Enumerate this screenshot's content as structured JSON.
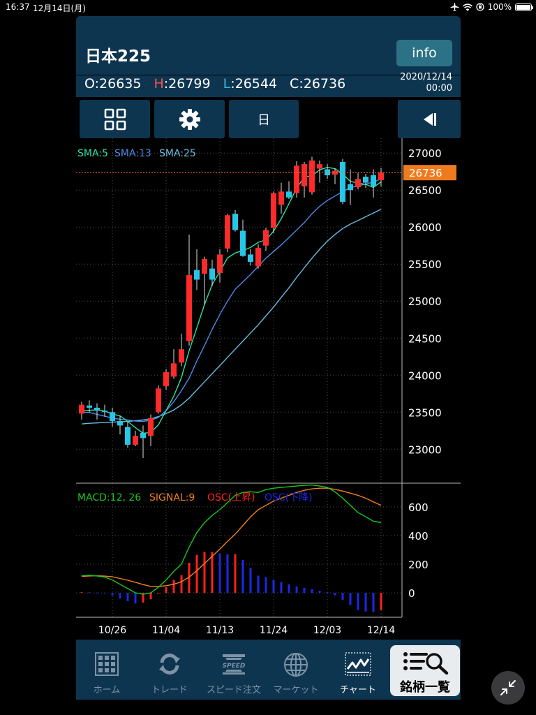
{
  "status": {
    "time": "16:37",
    "date": "12月14日(月)",
    "battery": "100%"
  },
  "header": {
    "title": "日本225",
    "info_label": "info",
    "ohlc": [
      {
        "label": "O",
        "value": ":26635"
      },
      {
        "label": "H",
        "value": ":26799"
      },
      {
        "label": "L",
        "value": ":26544"
      },
      {
        "label": "C",
        "value": ":26736"
      }
    ],
    "stamp_date": "2020/12/14",
    "stamp_time": "00:00"
  },
  "toolbar": {
    "period_label": "日"
  },
  "nav": {
    "items": [
      {
        "label": "ホーム",
        "icon": "grid-icon"
      },
      {
        "label": "トレード",
        "icon": "refresh-icon"
      },
      {
        "label": "スピード注文",
        "icon": "speed-icon"
      },
      {
        "label": "マーケット",
        "icon": "globe-icon"
      },
      {
        "label": "チャート",
        "icon": "chart-icon"
      }
    ],
    "stock_list_label": "銘柄一覧"
  },
  "colors": {
    "up": "#ff2a2a",
    "down": "#27c6e6",
    "sma5": "#2fe0a0",
    "sma13": "#4f8be8",
    "sma25": "#68bde3",
    "macd": "#18c818",
    "signal": "#f08020",
    "osc_up": "#ff2020",
    "osc_down": "#1e28e8",
    "last_price_bg": "#f07a1e",
    "panel": "#0e3550"
  },
  "chart_data": [
    {
      "type": "candlestick",
      "price_axis": {
        "ticks": [
          27000,
          26500,
          26000,
          25500,
          25000,
          24500,
          24000,
          23500,
          23000
        ],
        "range": [
          22550,
          27200
        ]
      },
      "x_tick_labels": [
        "10/26",
        "11/04",
        "11/13",
        "11/24",
        "12/03",
        "12/14"
      ],
      "legend": [
        "SMA:5",
        "SMA:13",
        "SMA:25"
      ],
      "last_price_label": "26736",
      "candles": [
        {
          "o": 23480,
          "h": 23640,
          "l": 23400,
          "c": 23600
        },
        {
          "o": 23590,
          "h": 23660,
          "l": 23500,
          "c": 23560
        },
        {
          "o": 23560,
          "h": 23620,
          "l": 23400,
          "c": 23520
        },
        {
          "o": 23520,
          "h": 23600,
          "l": 23440,
          "c": 23500
        },
        {
          "o": 23500,
          "h": 23560,
          "l": 23300,
          "c": 23380
        },
        {
          "o": 23380,
          "h": 23450,
          "l": 23200,
          "c": 23320
        },
        {
          "o": 23300,
          "h": 23370,
          "l": 23020,
          "c": 23060
        },
        {
          "o": 23060,
          "h": 23250,
          "l": 23040,
          "c": 23180
        },
        {
          "o": 23220,
          "h": 23320,
          "l": 22880,
          "c": 23150
        },
        {
          "o": 23180,
          "h": 23470,
          "l": 23040,
          "c": 23420
        },
        {
          "o": 23500,
          "h": 23860,
          "l": 23480,
          "c": 23820
        },
        {
          "o": 23850,
          "h": 24080,
          "l": 23800,
          "c": 24040
        },
        {
          "o": 23980,
          "h": 24350,
          "l": 23950,
          "c": 24160
        },
        {
          "o": 24170,
          "h": 24560,
          "l": 24120,
          "c": 24350
        },
        {
          "o": 24460,
          "h": 25900,
          "l": 24400,
          "c": 25350
        },
        {
          "o": 25420,
          "h": 25700,
          "l": 25150,
          "c": 25290
        },
        {
          "o": 25370,
          "h": 25600,
          "l": 24950,
          "c": 25570
        },
        {
          "o": 25440,
          "h": 25560,
          "l": 25200,
          "c": 25290
        },
        {
          "o": 25380,
          "h": 25700,
          "l": 25250,
          "c": 25630
        },
        {
          "o": 25710,
          "h": 26180,
          "l": 25660,
          "c": 26160
        },
        {
          "o": 26180,
          "h": 26230,
          "l": 25940,
          "c": 25960
        },
        {
          "o": 25950,
          "h": 26100,
          "l": 25600,
          "c": 25610
        },
        {
          "o": 25630,
          "h": 25700,
          "l": 25480,
          "c": 25530
        },
        {
          "o": 25470,
          "h": 25770,
          "l": 25440,
          "c": 25720
        },
        {
          "o": 25750,
          "h": 25990,
          "l": 25680,
          "c": 25960
        },
        {
          "o": 25990,
          "h": 26480,
          "l": 25920,
          "c": 26460
        },
        {
          "o": 26300,
          "h": 26600,
          "l": 26180,
          "c": 26480
        },
        {
          "o": 26480,
          "h": 26620,
          "l": 26380,
          "c": 26400
        },
        {
          "o": 26460,
          "h": 26890,
          "l": 26400,
          "c": 26830
        },
        {
          "o": 26550,
          "h": 26880,
          "l": 26400,
          "c": 26850
        },
        {
          "o": 26470,
          "h": 26950,
          "l": 26440,
          "c": 26900
        },
        {
          "o": 26790,
          "h": 26900,
          "l": 26600,
          "c": 26850
        },
        {
          "o": 26780,
          "h": 26850,
          "l": 26650,
          "c": 26700
        },
        {
          "o": 26710,
          "h": 26790,
          "l": 26580,
          "c": 26760
        },
        {
          "o": 26880,
          "h": 26920,
          "l": 26310,
          "c": 26340
        },
        {
          "o": 26580,
          "h": 26780,
          "l": 26300,
          "c": 26500
        },
        {
          "o": 26540,
          "h": 26730,
          "l": 26510,
          "c": 26650
        },
        {
          "o": 26680,
          "h": 26720,
          "l": 26530,
          "c": 26600
        },
        {
          "o": 26700,
          "h": 26780,
          "l": 26400,
          "c": 26550
        },
        {
          "o": 26635,
          "h": 26799,
          "l": 26544,
          "c": 26736
        }
      ],
      "sma5": [
        23520,
        23525,
        23530,
        23515,
        23475,
        23450,
        23375,
        23290,
        23215,
        23225,
        23330,
        23522,
        23718,
        23969,
        24330,
        24637,
        24954,
        25224,
        25399,
        25583,
        25650,
        25682,
        25725,
        25795,
        25826,
        25945,
        26114,
        26315,
        26527,
        26672,
        26694,
        26774,
        26807,
        26790,
        26718,
        26617,
        26594,
        26578,
        26535,
        26611
      ],
      "sma13": [
        23500,
        23495,
        23470,
        23445,
        23420,
        23405,
        23395,
        23380,
        23375,
        23390,
        23430,
        23520,
        23640,
        23790,
        23960,
        24190,
        24400,
        24620,
        24820,
        25000,
        25160,
        25260,
        25360,
        25470,
        25580,
        25670,
        25760,
        25860,
        25960,
        26060,
        26180,
        26280,
        26360,
        26420,
        26480,
        26530,
        26560,
        26580,
        26610,
        26650
      ],
      "sma25": [
        23340,
        23350,
        23355,
        23360,
        23365,
        23370,
        23375,
        23385,
        23395,
        23410,
        23440,
        23480,
        23530,
        23600,
        23690,
        23800,
        23910,
        24020,
        24130,
        24240,
        24350,
        24460,
        24570,
        24680,
        24800,
        24920,
        25050,
        25180,
        25320,
        25450,
        25580,
        25700,
        25810,
        25900,
        25980,
        26040,
        26090,
        26140,
        26190,
        26240
      ]
    },
    {
      "type": "macd",
      "legend": [
        "MACD:12, 26",
        "SIGNAL:9",
        "OSC(上昇)",
        "OSC(下降)"
      ],
      "y_ticks": [
        600,
        400,
        200,
        0
      ],
      "range": [
        -170,
        760
      ],
      "macd": [
        120,
        122,
        118,
        110,
        90,
        60,
        30,
        0,
        -10,
        0,
        40,
        90,
        150,
        200,
        320,
        420,
        490,
        540,
        580,
        630,
        680,
        700,
        705,
        700,
        720,
        730,
        735,
        740,
        745,
        750,
        752,
        745,
        735,
        705,
        660,
        610,
        560,
        530,
        500,
        490
      ],
      "signal": [
        115,
        118,
        119,
        117,
        112,
        100,
        88,
        74,
        58,
        45,
        44,
        50,
        60,
        78,
        110,
        155,
        205,
        255,
        305,
        360,
        410,
        470,
        530,
        580,
        610,
        640,
        660,
        680,
        700,
        715,
        725,
        730,
        730,
        722,
        710,
        695,
        680,
        660,
        635,
        610
      ],
      "osc": [
        5,
        4,
        2,
        -5,
        -18,
        -40,
        -58,
        -74,
        -68,
        -45,
        -4,
        40,
        90,
        122,
        210,
        265,
        285,
        285,
        275,
        270,
        270,
        230,
        175,
        120,
        110,
        90,
        75,
        60,
        45,
        35,
        27,
        15,
        5,
        -17,
        -50,
        -85,
        -120,
        -130,
        -135,
        -120
      ]
    }
  ]
}
